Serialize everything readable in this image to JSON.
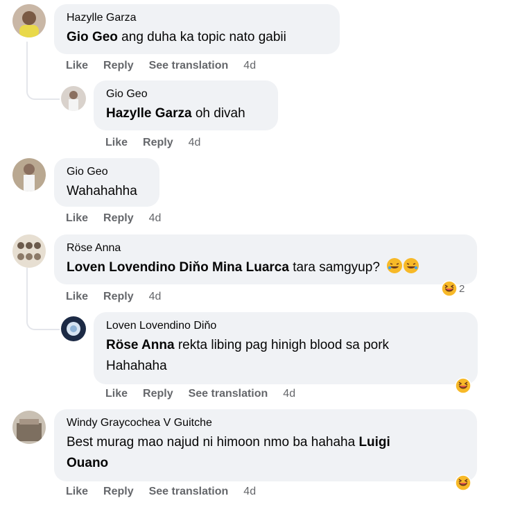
{
  "comments": [
    {
      "author": "Hazylle Garza",
      "mention": "Gio Geo",
      "text": " ang duha ka topic nato gabii",
      "actions": {
        "like": "Like",
        "reply": "Reply",
        "translate": "See translation",
        "time": "4d"
      }
    },
    {
      "author": "Gio Geo",
      "mention": "Hazylle Garza",
      "text": " oh divah",
      "actions": {
        "like": "Like",
        "reply": "Reply",
        "time": "4d"
      }
    },
    {
      "author": "Gio Geo",
      "text": "Wahahahha",
      "actions": {
        "like": "Like",
        "reply": "Reply",
        "time": "4d"
      }
    },
    {
      "author": "Röse Anna",
      "mention": "Loven Lovendino Diňo Mina Luarca",
      "text": " tara samgyup?",
      "reaction_count": "2",
      "actions": {
        "like": "Like",
        "reply": "Reply",
        "time": "4d"
      }
    },
    {
      "author": "Loven Lovendino Diňo",
      "mention": "Röse Anna",
      "text": " rekta libing pag hinigh blood sa pork",
      "text2": "Hahahaha",
      "actions": {
        "like": "Like",
        "reply": "Reply",
        "translate": "See translation",
        "time": "4d"
      }
    },
    {
      "author": "Windy Graycochea V Guitche",
      "text": "Best murag mao najud ni himoon nmo ba hahaha ",
      "mention": "Luigi",
      "mention2": "Ouano",
      "actions": {
        "like": "Like",
        "reply": "Reply",
        "translate": "See translation",
        "time": "4d"
      }
    }
  ],
  "colors": {
    "bubble": "#f0f2f5",
    "action": "#65676b",
    "text": "#050505",
    "thread": "#e4e6eb",
    "haha": "#f7b928"
  },
  "icons": {
    "reaction": "haha-emoji-icon",
    "inline_emoji": "rofl-emoji-icon"
  }
}
